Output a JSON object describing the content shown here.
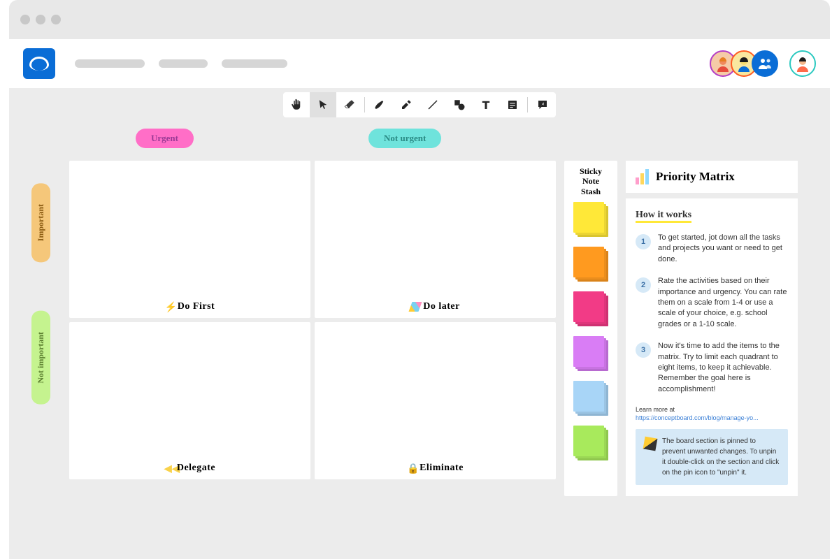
{
  "pills": {
    "urgent": "Urgent",
    "not_urgent": "Not urgent"
  },
  "side": {
    "important": "Important",
    "not_important": "Not important"
  },
  "quadrants": {
    "q1": "Do First",
    "q2": "Do later",
    "q3": "Delegate",
    "q4": "Eliminate"
  },
  "stash": {
    "title_l1": "Sticky",
    "title_l2": "Note",
    "title_l3": "Stash"
  },
  "panel": {
    "title": "Priority Matrix",
    "how_it_works": "How it works",
    "steps": [
      {
        "n": "1",
        "text": "To get started, jot down all the tasks and projects you want or need to get done."
      },
      {
        "n": "2",
        "text": "Rate the activities based on their importance and urgency. You can rate them on a scale from 1-4 or use a scale of your choice, e.g. school grades or a 1-10 scale."
      },
      {
        "n": "3",
        "text": "Now it's time to add the items to the matrix. Try to limit each quadrant to eight items, to keep it achievable. Remember the goal here is accomplishment!"
      }
    ],
    "learn_label": "Learn more at",
    "learn_url": "https://conceptboard.com/blog/manage-yo...",
    "note": "The board section is pinned to prevent unwanted changes. To unpin it double-click on the section and click on the pin icon to \"unpin\" it."
  }
}
